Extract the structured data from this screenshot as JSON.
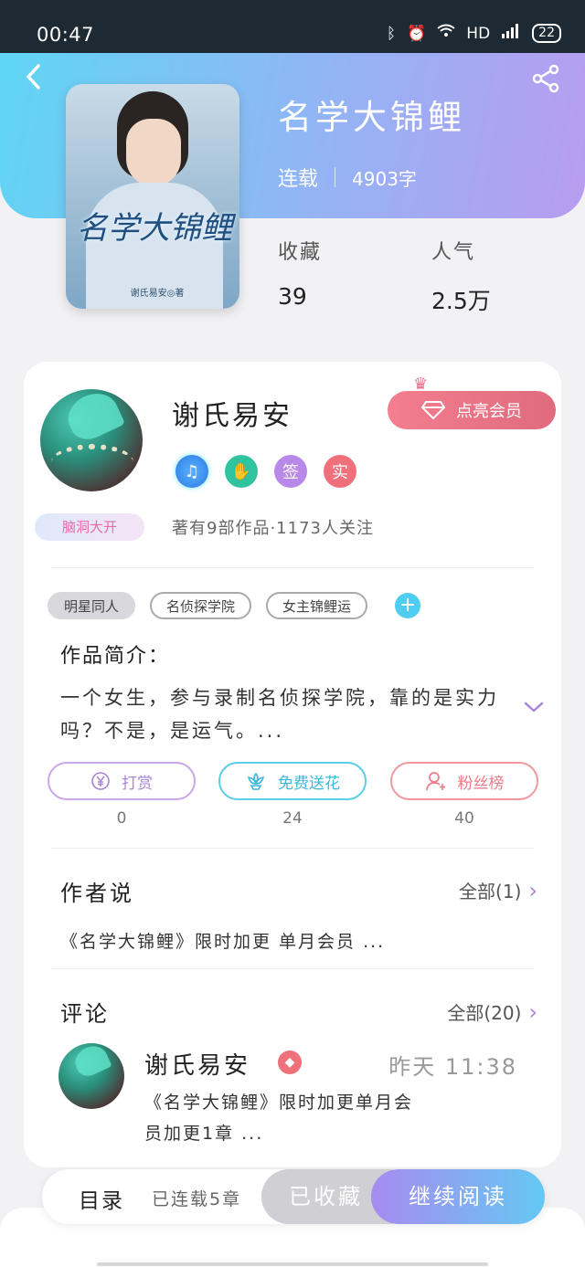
{
  "status": {
    "time": "00:47",
    "network": "HD",
    "battery": "22"
  },
  "book": {
    "cover_title": "名学大锦鲤",
    "cover_author": "谢氏易安◎著",
    "title": "名学大锦鲤",
    "status": "连载",
    "word_count": "4903字",
    "stats": [
      {
        "label": "收藏",
        "value": "39"
      },
      {
        "label": "人气",
        "value": "2.5万"
      }
    ]
  },
  "author": {
    "name": "谢氏易安",
    "badge": "脑洞大开",
    "vip_button": "点亮会员",
    "badges": [
      {
        "icon": "music-note-icon",
        "text": "♫"
      },
      {
        "icon": "handshake-icon",
        "text": "✋"
      },
      {
        "icon": "sign-badge",
        "text": "签"
      },
      {
        "icon": "real-name-badge",
        "text": "实"
      }
    ],
    "stats_text": "著有9部作品·1173人关注"
  },
  "tags": [
    "明星同人",
    "名侦探学院",
    "女主锦鲤运"
  ],
  "intro": {
    "title": "作品简介：",
    "text": "一个女生，参与录制名侦探学院，靠的是实力吗？不是，是运气。..."
  },
  "actions": [
    {
      "label": "打赏",
      "count": "0",
      "icon": "yen-icon",
      "color": "#a985d6"
    },
    {
      "label": "免费送花",
      "count": "24",
      "icon": "flower-icon",
      "color": "#3fb8d8"
    },
    {
      "label": "粉丝榜",
      "count": "40",
      "icon": "fans-icon",
      "color": "#ec7c88"
    }
  ],
  "author_say": {
    "title": "作者说",
    "all": "全部(1)",
    "text": "《名学大锦鲤》限时加更 单月会员 ..."
  },
  "comments": {
    "title": "评论",
    "all": "全部(20)",
    "items": [
      {
        "name": "谢氏易安",
        "time": "昨天 11:38",
        "text": "《名学大锦鲤》限时加更单月会员加更1章 ..."
      }
    ]
  },
  "bottom": {
    "toc": "目录",
    "toc_count": "已连载5章",
    "favorited": "已收藏",
    "continue": "继续阅读"
  }
}
